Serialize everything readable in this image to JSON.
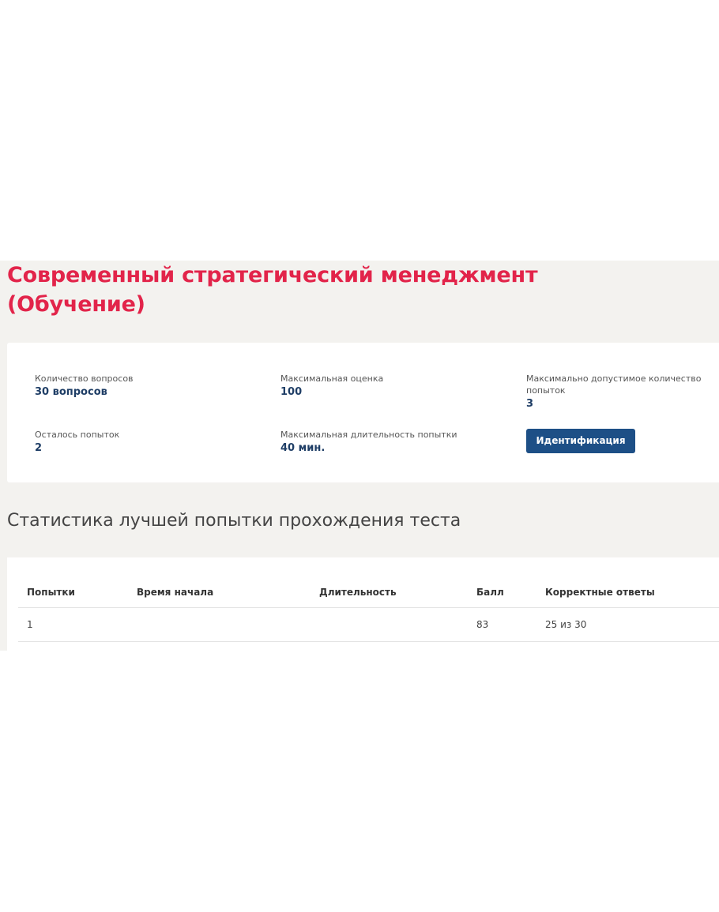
{
  "course": {
    "title": "Современный стратегический менеджмент (Обучение)"
  },
  "info": {
    "questions_count": {
      "label": "Количество вопросов",
      "value": "30 вопросов"
    },
    "max_score": {
      "label": "Максимальная оценка",
      "value": "100"
    },
    "max_attempts": {
      "label": "Максимально допустимое количество попыток",
      "value": "3"
    },
    "attempts_left": {
      "label": "Осталось попыток",
      "value": "2"
    },
    "max_duration": {
      "label": "Максимальная длительность попытки",
      "value": "40 мин."
    },
    "identification_button": "Идентификация"
  },
  "stats": {
    "title": "Статистика лучшей попытки прохождения теста",
    "columns": {
      "attempts": "Попытки",
      "start_time": "Время начала",
      "duration": "Длительность",
      "score": "Балл",
      "correct_answers": "Корректные ответы"
    },
    "rows": [
      {
        "attempt": "1",
        "start_time": "",
        "duration": "",
        "score": "83",
        "correct_answers": "25 из 30"
      }
    ]
  },
  "colors": {
    "title_accent": "#e2244a",
    "value_text": "#1f3e66",
    "button_bg": "#1d4f86",
    "panel_bg": "#f3f2ef"
  }
}
